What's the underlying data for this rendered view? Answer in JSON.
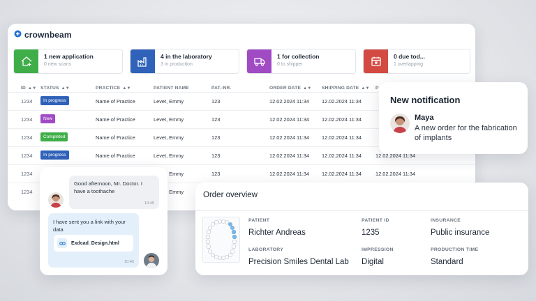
{
  "brand": {
    "name": "crownbeam",
    "accent": "#1f6fd0"
  },
  "stats": [
    {
      "title": "1 new application",
      "subtitle": "0 new scans",
      "color": "#3fae49",
      "icon": "house-plus-icon"
    },
    {
      "title": "4 in the laboratory",
      "subtitle": "3 in production",
      "color": "#2f62b8",
      "icon": "factory-icon"
    },
    {
      "title": "1 for collection",
      "subtitle": "0 to shipper",
      "color": "#a04ac4",
      "icon": "truck-icon"
    },
    {
      "title": "0 due tod...",
      "subtitle": "1 overlapping",
      "color": "#d24a42",
      "icon": "calendar-icon"
    }
  ],
  "table": {
    "headers": {
      "id": "ID",
      "status": "STATUS",
      "practice": "PRACTICE",
      "patient": "PATIENT NAME",
      "patnr": "PAT.-NR.",
      "order": "ORDER DATE",
      "shipping": "SHIPPING DATE",
      "extra": "P"
    },
    "rows": [
      {
        "id": "1234",
        "status": "In progress",
        "status_color": "#2f62b8",
        "practice": "Name of Practice",
        "patient": "Levet, Emmy",
        "patnr": "123",
        "order": "12.02.2024 11:34",
        "shipping": "12.02.2024 11:34",
        "extra": ""
      },
      {
        "id": "1234",
        "status": "New",
        "status_color": "#a04ac4",
        "practice": "Name of Practice",
        "patient": "Levet, Emmy",
        "patnr": "123",
        "order": "12.02.2024 11:34",
        "shipping": "12.02.2024 11:34",
        "extra": ""
      },
      {
        "id": "1234",
        "status": "Completed",
        "status_color": "#3fae49",
        "practice": "Name of Practice",
        "patient": "Levet, Emmy",
        "patnr": "123",
        "order": "12.02.2024 11:34",
        "shipping": "12.02.2024 11:34",
        "extra": ""
      },
      {
        "id": "1234",
        "status": "In progress",
        "status_color": "#2f62b8",
        "practice": "Name of Practice",
        "patient": "Levet, Emmy",
        "patnr": "123",
        "order": "12.02.2024 11:34",
        "shipping": "12.02.2024 11:34",
        "extra": "12.02.2024 11:34"
      },
      {
        "id": "1234",
        "status": "",
        "status_color": "",
        "practice": "",
        "patient": "Levet, Emmy",
        "patnr": "123",
        "order": "12.02.2024 11:34",
        "shipping": "12.02.2024 11:34",
        "extra": "12.02.2024 11:34"
      },
      {
        "id": "1234",
        "status": "",
        "status_color": "",
        "practice": "",
        "patient": "Levet, Emmy",
        "patnr": "123",
        "order": "",
        "shipping": "",
        "extra": ""
      }
    ]
  },
  "notification": {
    "title": "New notification",
    "sender": "Maya",
    "message": "A new order for the fabrication of implants"
  },
  "chat": {
    "incoming": {
      "text": "Good afternoon, Mr. Doctor. I have a toothache",
      "time": "10:45"
    },
    "outgoing": {
      "text": "I have sent you a link with your data",
      "file": "Exdcad_Design.html",
      "time": "10:45"
    }
  },
  "order_overview": {
    "title": "Order overview",
    "patient_label": "PATIENT",
    "patient": "Richter Andreas",
    "patient_id_label": "PATIENT ID",
    "patient_id": "1235",
    "insurance_label": "INSURANCE",
    "insurance": "Public insurance",
    "laboratory_label": "LABORATORY",
    "laboratory": "Precision Smiles Dental Lab",
    "impression_label": "IMPRESSION",
    "impression": "Digital",
    "production_label": "PRODUCTION TIME",
    "production": "Standard"
  }
}
